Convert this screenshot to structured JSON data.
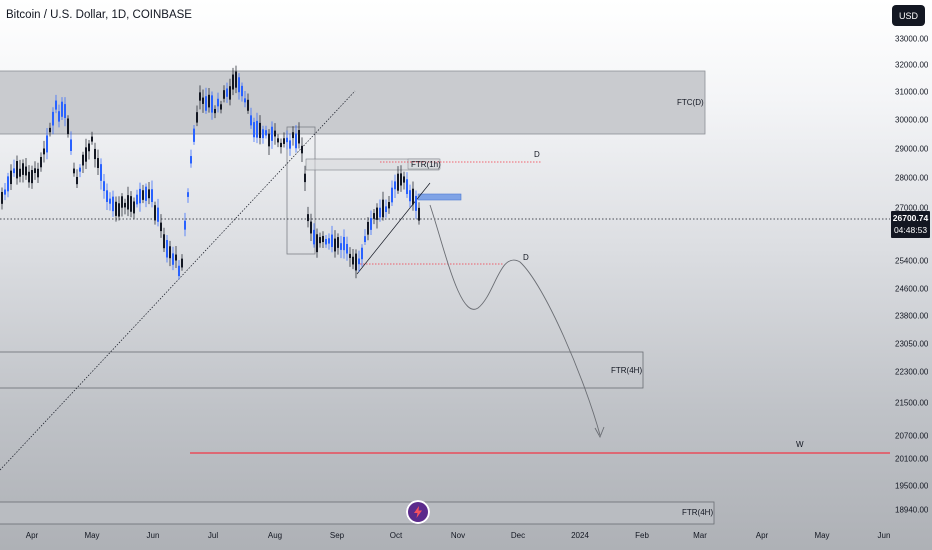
{
  "header": {
    "title": "Bitcoin / U.S. Dollar, 1D, COINBASE",
    "currency_button": "USD"
  },
  "price_scale": {
    "ticks": [
      "33000.00",
      "32000.00",
      "31000.00",
      "30000.00",
      "29000.00",
      "28000.00",
      "27000.00",
      "25400.00",
      "24600.00",
      "23800.00",
      "23050.00",
      "22300.00",
      "21500.00",
      "20700.00",
      "20100.00",
      "19500.00",
      "18940.00"
    ],
    "current_price": "26700.74",
    "countdown": "04:48:53"
  },
  "time_scale": {
    "ticks": [
      "Apr",
      "May",
      "Jun",
      "Jul",
      "Aug",
      "Sep",
      "Oct",
      "Nov",
      "Dec",
      "2024",
      "Feb",
      "Mar",
      "Apr",
      "May",
      "Jun"
    ]
  },
  "annotations": {
    "ftc_d": "FTC(D)",
    "ftr_1h": "FTR(1h)",
    "d_upper": "D",
    "d_lower": "D",
    "ftr_4h_mid": "FTR(4H)",
    "ftr_4h_bottom": "FTR(4H)",
    "w": "W"
  },
  "colors": {
    "up_candle": "#2962ff",
    "down_candle": "#131722",
    "red_line": "#f23645",
    "zone_fill": "#c5c8cd",
    "badge": "#5b2a8c"
  },
  "icons": {
    "logo": "lightning-icon"
  }
}
